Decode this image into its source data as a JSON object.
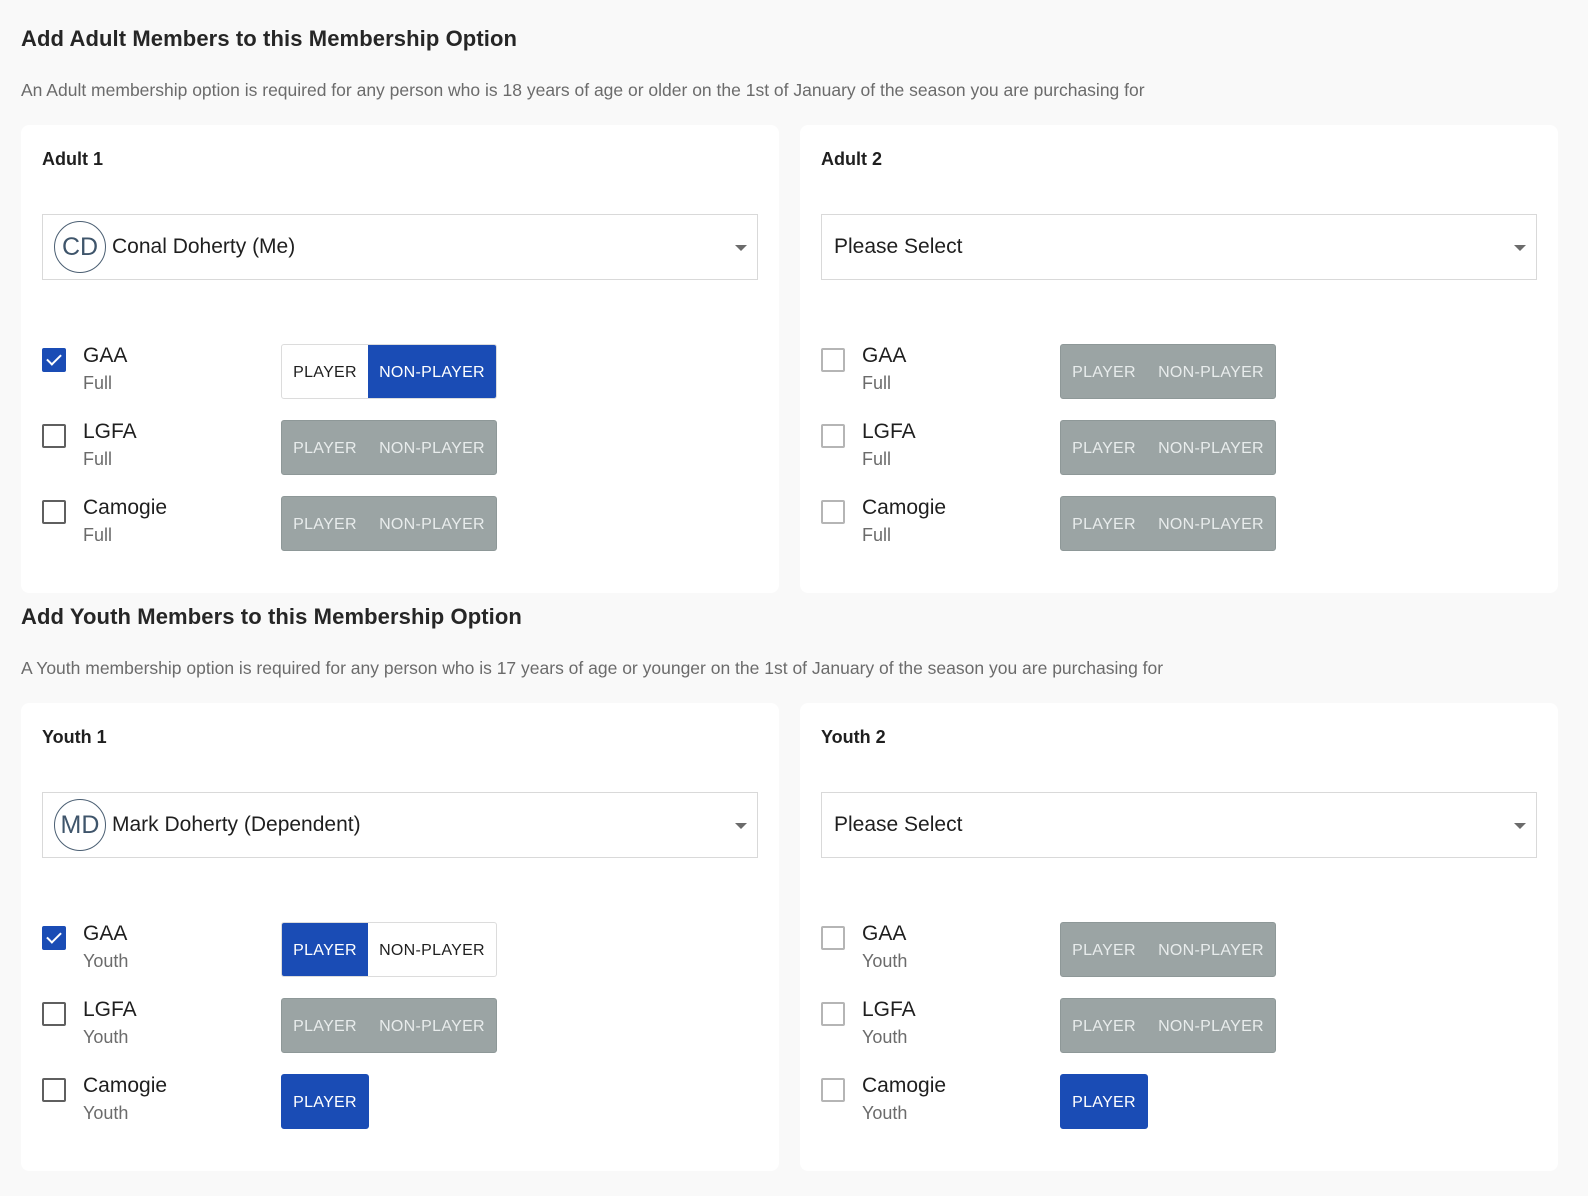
{
  "adult_section": {
    "title": "Add Adult Members to this Membership Option",
    "description": "An Adult membership option is required for any person who is 18 years of age or older on the 1st of January of the season you are purchasing for"
  },
  "youth_section": {
    "title": "Add Youth Members to this Membership Option",
    "description": "A Youth membership option is required for any person who is 17 years of age or younger on the 1st of January of the season you are purchasing for"
  },
  "labels": {
    "player": "PLAYER",
    "non_player": "NON-PLAYER",
    "please_select": "Please Select"
  },
  "adult1": {
    "title": "Adult 1",
    "initials": "CD",
    "member": "Conal Doherty (Me)",
    "rows": [
      {
        "name": "GAA",
        "type": "Full",
        "checked": true,
        "selected": "NON-PLAYER"
      },
      {
        "name": "LGFA",
        "type": "Full",
        "checked": false
      },
      {
        "name": "Camogie",
        "type": "Full",
        "checked": false
      }
    ]
  },
  "adult2": {
    "title": "Adult 2",
    "rows": [
      {
        "name": "GAA",
        "type": "Full",
        "checked": false
      },
      {
        "name": "LGFA",
        "type": "Full",
        "checked": false
      },
      {
        "name": "Camogie",
        "type": "Full",
        "checked": false
      }
    ]
  },
  "youth1": {
    "title": "Youth 1",
    "initials": "MD",
    "member": "Mark Doherty (Dependent)",
    "rows": [
      {
        "name": "GAA",
        "type": "Youth",
        "checked": true,
        "selected": "PLAYER"
      },
      {
        "name": "LGFA",
        "type": "Youth",
        "checked": false
      },
      {
        "name": "Camogie",
        "type": "Youth",
        "checked": false
      }
    ]
  },
  "youth2": {
    "title": "Youth 2",
    "rows": [
      {
        "name": "GAA",
        "type": "Youth",
        "checked": false
      },
      {
        "name": "LGFA",
        "type": "Youth",
        "checked": false
      },
      {
        "name": "Camogie",
        "type": "Youth",
        "checked": false
      }
    ]
  },
  "colors": {
    "accent": "#1a4cb5",
    "disabled_button": "#9ba4a4",
    "page_background": "#f9f9f9"
  }
}
